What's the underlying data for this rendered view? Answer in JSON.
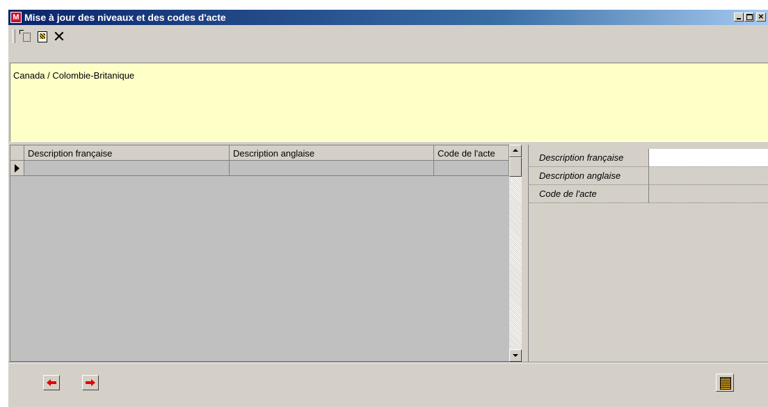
{
  "window": {
    "icon_letter": "M",
    "title": "Mise à jour des niveaux et des codes d'acte"
  },
  "toolbar": {
    "buttons": [
      {
        "name": "new-record",
        "icon": "new-document-icon"
      },
      {
        "name": "edit-record",
        "icon": "edit-document-icon"
      },
      {
        "name": "delete-record",
        "icon": "delete-icon"
      }
    ],
    "delete_glyph": "✕"
  },
  "info_panel": {
    "path": "Canada / Colombie-Britanique",
    "background": "#ffffc8"
  },
  "grid": {
    "columns": [
      "Description française",
      "Description anglaise",
      "Code de l'acte"
    ],
    "rows": [
      [
        "",
        "",
        ""
      ]
    ]
  },
  "properties": {
    "rows": [
      {
        "label": "Description française",
        "value": ""
      },
      {
        "label": "Description anglaise",
        "value": ""
      },
      {
        "label": "Code de l'acte",
        "value": ""
      }
    ]
  },
  "footer": {
    "buttons": [
      {
        "name": "previous",
        "icon": "red-left-arrow-icon"
      },
      {
        "name": "next",
        "icon": "red-right-arrow-icon"
      },
      {
        "name": "tools",
        "icon": "tools-icon"
      }
    ]
  }
}
